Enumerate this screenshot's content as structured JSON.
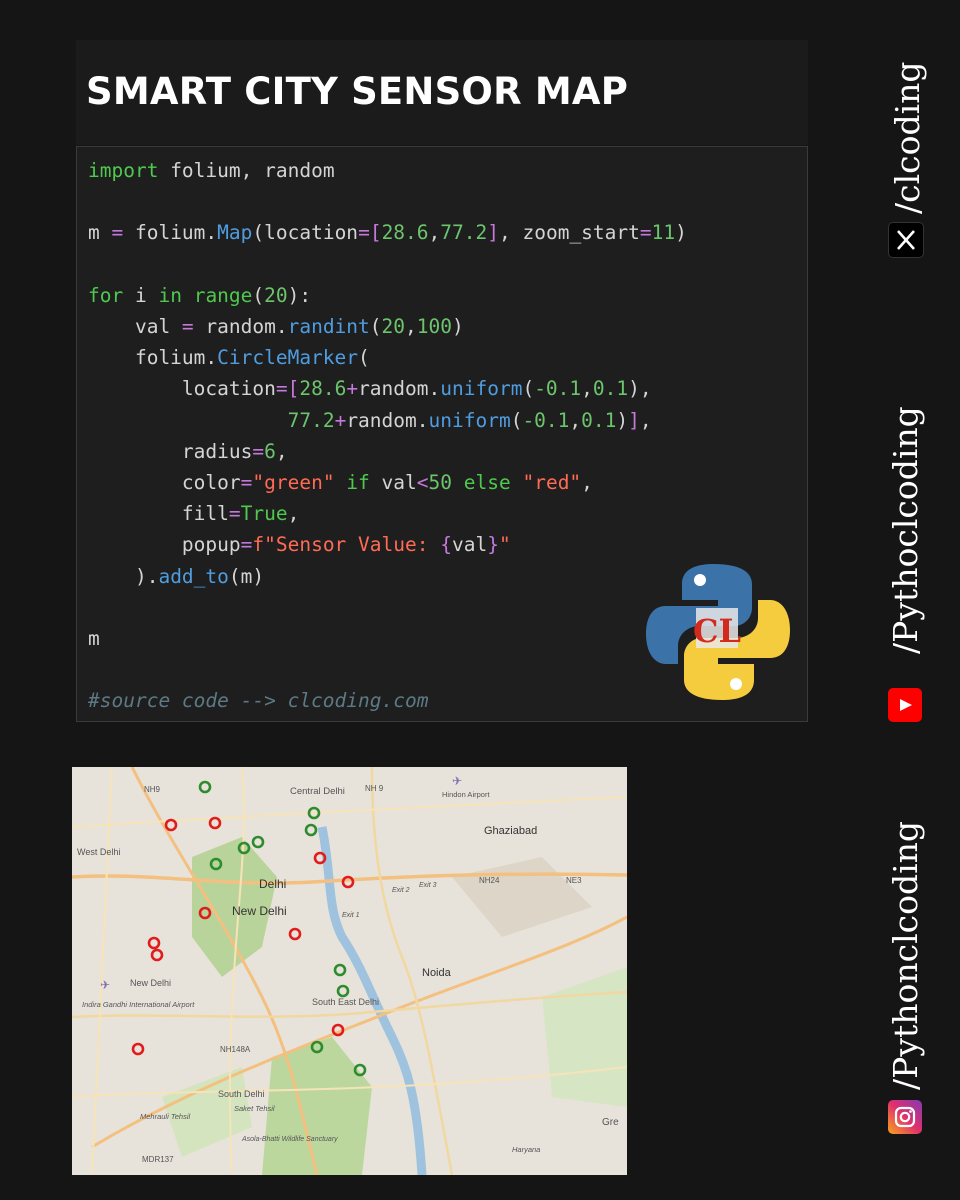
{
  "title": "SMART CITY SENSOR MAP",
  "code": {
    "line1": {
      "kw": "import",
      "rest": " folium, random"
    },
    "line3": {
      "a": "m ",
      "eq": "=",
      "b": " folium.",
      "fn": "Map",
      "c": "(location",
      "eq2": "=",
      "lb": "[",
      "n1": "28.6",
      "comma": ",",
      "n2": "77.2",
      "rb": "]",
      "d": ", zoom_start",
      "eq3": "=",
      "n3": "11",
      "e": ")"
    },
    "line5": {
      "kw1": "for",
      "a": " i ",
      "kw2": "in",
      "sp": " ",
      "fn": "range",
      "b": "(",
      "n": "20",
      "c": "):"
    },
    "line6": {
      "a": "    val ",
      "eq": "=",
      "b": " random.",
      "fn": "randint",
      "c": "(",
      "n1": "20",
      "comma": ",",
      "n2": "100",
      "d": ")"
    },
    "line7": {
      "a": "    folium.",
      "fn": "CircleMarker",
      "b": "("
    },
    "line8": {
      "a": "        location",
      "eq": "=",
      "lb": "[",
      "n1": "28.6",
      "plus": "+",
      "b": "random.",
      "fn": "uniform",
      "c": "(",
      "n2": "-0.1",
      "comma": ",",
      "n3": "0.1",
      "d": "),"
    },
    "line9": {
      "a": "                 ",
      "n1": "77.2",
      "plus": "+",
      "b": "random.",
      "fn": "uniform",
      "c": "(",
      "n2": "-0.1",
      "comma": ",",
      "n3": "0.1",
      "d": ")",
      "rb": "]",
      "e": ","
    },
    "line10": {
      "a": "        radius",
      "eq": "=",
      "n": "6",
      "b": ","
    },
    "line11": {
      "a": "        color",
      "eq": "=",
      "s1": "\"green\"",
      "sp": " ",
      "kw1": "if",
      "b": " val",
      "lt": "<",
      "n": "50",
      "sp2": " ",
      "kw2": "else",
      "sp3": " ",
      "s2": "\"red\"",
      "c": ","
    },
    "line12": {
      "a": "        fill",
      "eq": "=",
      "kw": "True",
      "b": ","
    },
    "line13": {
      "a": "        popup",
      "eq": "=",
      "s": "f\"Sensor Value: ",
      "b1": "{",
      "v": "val",
      "b2": "}",
      "s2": "\""
    },
    "line14": {
      "a": "    ).",
      "fn": "add_to",
      "b": "(m)"
    },
    "line16": {
      "a": "m"
    },
    "line18": {
      "cm": "#source code --> clcoding.com"
    }
  },
  "logo": {
    "text": "CL",
    "name": "python-clcoding-logo"
  },
  "map": {
    "labels": [
      "NH9",
      "Central Delhi",
      "NH 9",
      "Hindon Airport",
      "Ghaziabad",
      "West Delhi",
      "Delhi",
      "New Delhi",
      "NH24",
      "NE3",
      "Noida",
      "New Delhi",
      "Indira Gandhi International Airport",
      "South East Delhi",
      "NH148A",
      "South Delhi",
      "Mehrauli Tehsil",
      "Saket Tehsil",
      "Asola-Bhatti Wildlife Sanctuary",
      "MDR137",
      "Gre",
      "Haryana",
      "Exit 2",
      "Exit 3",
      "Exit 1"
    ],
    "markers_red": 10,
    "markers_green": 10,
    "colors": {
      "green": "#2e8b2e",
      "red": "#e01c1c"
    }
  },
  "sidebar": {
    "x_handle": "/clcoding",
    "youtube_handle": "/Pythoclcoding",
    "instagram_handle": "/Pythonclcoding"
  }
}
